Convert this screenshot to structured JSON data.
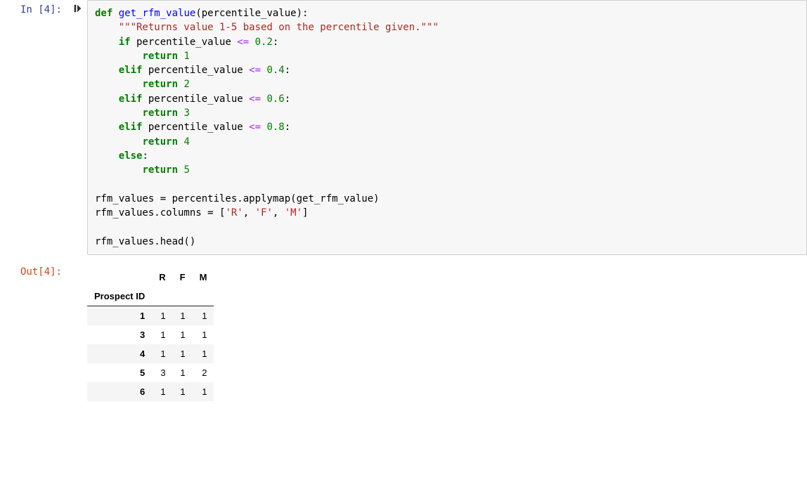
{
  "input": {
    "prompt": "In [4]:",
    "run_icon_name": "run-cell-icon",
    "code": {
      "line1": {
        "kw_def": "def",
        "sp": " ",
        "fn": "get_rfm_value",
        "rest": "(percentile_value):"
      },
      "line2": {
        "indent": "    ",
        "doc": "\"\"\"Returns value 1-5 based on the percentile given.\"\"\""
      },
      "line3": {
        "indent": "    ",
        "kw": "if",
        "rest1": " percentile_value ",
        "op": "<=",
        "sp": " ",
        "num": "0.2",
        "colon": ":"
      },
      "line4": {
        "indent": "        ",
        "kw": "return",
        "sp": " ",
        "num": "1"
      },
      "line5": {
        "indent": "    ",
        "kw": "elif",
        "rest1": " percentile_value ",
        "op": "<=",
        "sp": " ",
        "num": "0.4",
        "colon": ":"
      },
      "line6": {
        "indent": "        ",
        "kw": "return",
        "sp": " ",
        "num": "2"
      },
      "line7": {
        "indent": "    ",
        "kw": "elif",
        "rest1": " percentile_value ",
        "op": "<=",
        "sp": " ",
        "num": "0.6",
        "colon": ":"
      },
      "line8": {
        "indent": "        ",
        "kw": "return",
        "sp": " ",
        "num": "3"
      },
      "line9": {
        "indent": "    ",
        "kw": "elif",
        "rest1": " percentile_value ",
        "op": "<=",
        "sp": " ",
        "num": "0.8",
        "colon": ":"
      },
      "line10": {
        "indent": "        ",
        "kw": "return",
        "sp": " ",
        "num": "4"
      },
      "line11": {
        "indent": "    ",
        "kw": "else",
        "colon": ":"
      },
      "line12": {
        "indent": "        ",
        "kw": "return",
        "sp": " ",
        "num": "5"
      },
      "line13": {
        "text": ""
      },
      "line14": {
        "text": "rfm_values = percentiles.applymap(get_rfm_value)"
      },
      "line15": {
        "pre": "rfm_values.columns = [",
        "s1": "'R'",
        "c1": ", ",
        "s2": "'F'",
        "c2": ", ",
        "s3": "'M'",
        "post": "]"
      },
      "line16": {
        "text": ""
      },
      "line17": {
        "text": "rfm_values.head()"
      }
    }
  },
  "output": {
    "prompt": "Out[4]:",
    "table": {
      "columns": [
        "R",
        "F",
        "M"
      ],
      "index_name": "Prospect ID",
      "rows": [
        {
          "idx": "1",
          "R": "1",
          "F": "1",
          "M": "1"
        },
        {
          "idx": "3",
          "R": "1",
          "F": "1",
          "M": "1"
        },
        {
          "idx": "4",
          "R": "1",
          "F": "1",
          "M": "1"
        },
        {
          "idx": "5",
          "R": "3",
          "F": "1",
          "M": "2"
        },
        {
          "idx": "6",
          "R": "1",
          "F": "1",
          "M": "1"
        }
      ]
    }
  }
}
